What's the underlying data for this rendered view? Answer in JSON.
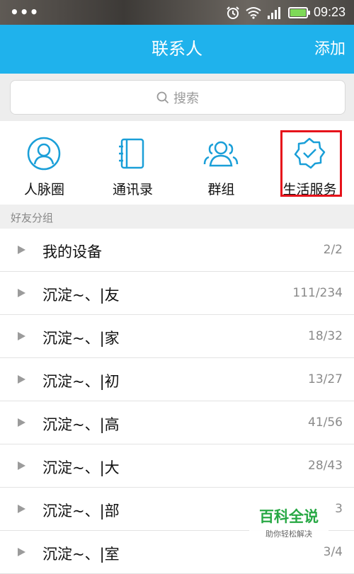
{
  "status_bar": {
    "dots": "•••",
    "time": "09:23",
    "icons": [
      "alarm-icon",
      "wifi-icon",
      "signal-icon",
      "battery-icon"
    ]
  },
  "header": {
    "title": "联系人",
    "add_label": "添加"
  },
  "search": {
    "placeholder": "搜索"
  },
  "shortcuts": [
    {
      "label": "人脉圈",
      "icon": "person-circle-icon"
    },
    {
      "label": "通讯录",
      "icon": "address-book-icon"
    },
    {
      "label": "群组",
      "icon": "group-icon"
    },
    {
      "label": "生活服务",
      "icon": "badge-check-icon"
    }
  ],
  "section": {
    "title": "好友分组"
  },
  "groups": [
    {
      "name": "我的设备",
      "count": "2/2"
    },
    {
      "name": "沉淀~、|友",
      "count": "111/234"
    },
    {
      "name": "沉淀~、|家",
      "count": "18/32"
    },
    {
      "name": "沉淀~、|初",
      "count": "13/27"
    },
    {
      "name": "沉淀~、|高",
      "count": "41/56"
    },
    {
      "name": "沉淀~、|大",
      "count": "28/43"
    },
    {
      "name": "沉淀~、|部",
      "count": "3"
    },
    {
      "name": "沉淀~、|室",
      "count": "3/4"
    }
  ],
  "watermark": {
    "title": "百科全说",
    "subtitle": "助你轻松解决"
  },
  "colors": {
    "header": "#1fb2ec",
    "accent_icon": "#1a9fd8",
    "highlight": "#e6131b"
  }
}
